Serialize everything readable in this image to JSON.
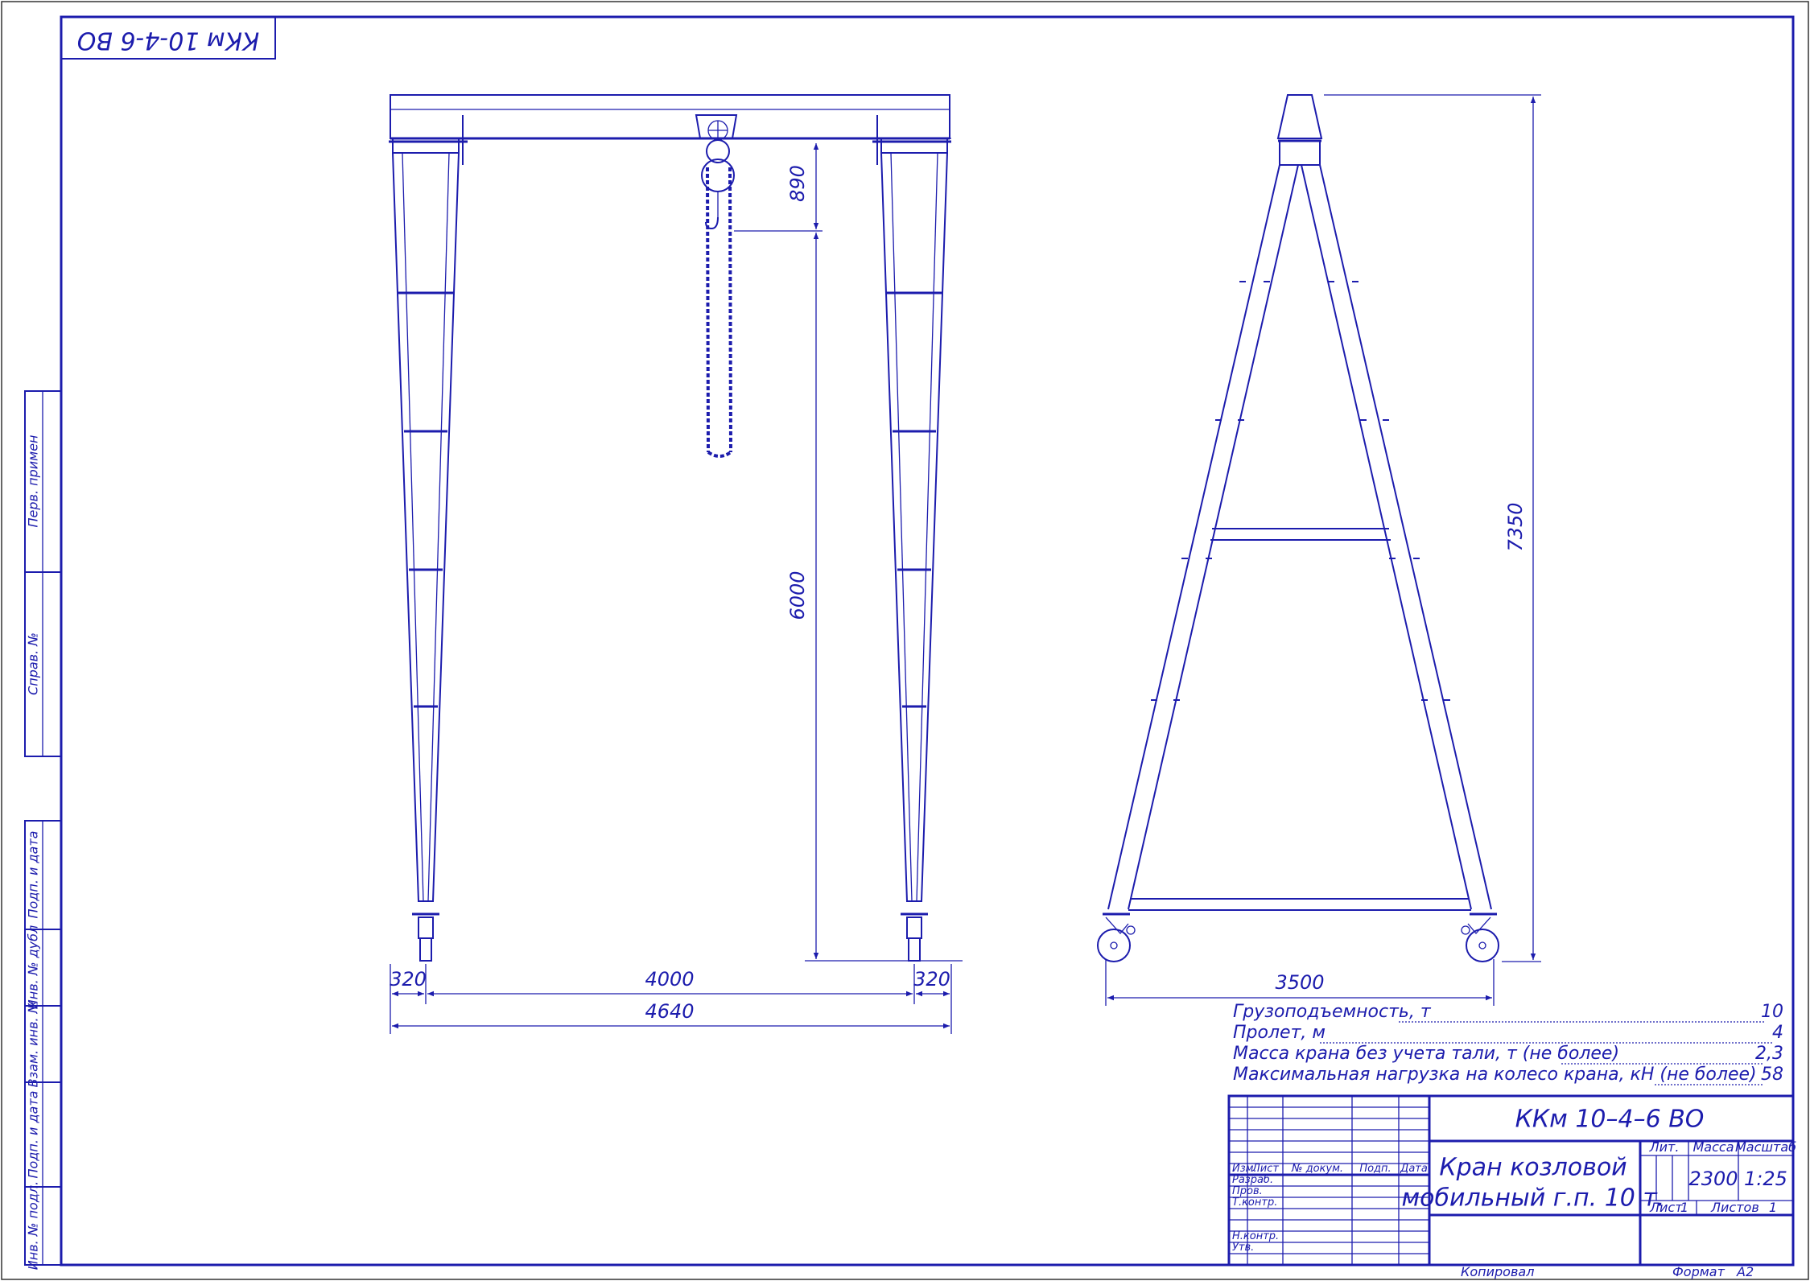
{
  "drawing": {
    "code_stamp": "ККм 10-4-6 ВО",
    "colors": {
      "line": "#1c1cad",
      "frame": "#333333",
      "background": "#ffffff"
    }
  },
  "side_stamps": [
    "Перв. примен",
    "Справ. №",
    "Подп. и дата",
    "Инв. № дубл",
    "Взам. инв. №",
    "Подп. и дата",
    "Инв. № подл."
  ],
  "front_view": {
    "dim_hook": "890",
    "dim_height": "6000",
    "dim_left": "320",
    "dim_span": "4000",
    "dim_right": "320",
    "dim_total": "4640"
  },
  "side_view": {
    "dim_height": "7350",
    "dim_base": "3500"
  },
  "specs": [
    {
      "label": "Грузоподъемность, т",
      "value": "10"
    },
    {
      "label": "Пролет, м",
      "value": "4"
    },
    {
      "label": "Масса крана без учета тали, т (не более)",
      "value": "2,3"
    },
    {
      "label": "Максимальная нагрузка на колесо крана, кН (не более)",
      "value": "58"
    }
  ],
  "title_block": {
    "designation": "ККм 10–4–6 ВО",
    "name_line1": "Кран козловой",
    "name_line2": "мобильный г.п. 10 т.",
    "col_izm": "Изм.",
    "col_list": "Лист",
    "col_doc": "№ докум.",
    "col_podp": "Подп.",
    "col_date": "Дата",
    "row_razrab": "Разраб.",
    "row_prov": "Пров.",
    "row_tkontr": "Т.контр.",
    "row_nkontr": "Н.контр.",
    "row_utv": "Утв.",
    "lit_label": "Лит.",
    "mass_label": "Масса",
    "scale_label": "Масштаб",
    "mass_value": "2300",
    "scale_value": "1:25",
    "sheet_label": "Лист",
    "sheet_value": "1",
    "sheets_label": "Листов",
    "sheets_value": "1",
    "copied": "Копировал",
    "format_label": "Формат",
    "format_value": "А2"
  }
}
